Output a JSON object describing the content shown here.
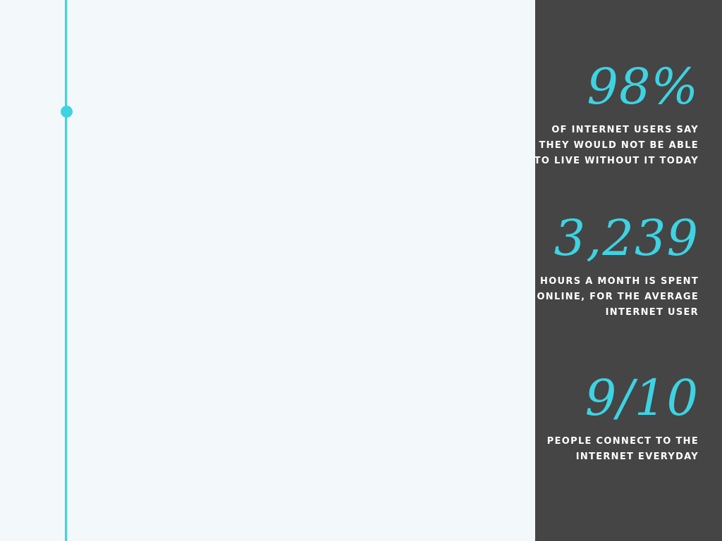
{
  "colors": {
    "background_light": "#f3f9fa",
    "panel_dark": "#454545",
    "accent": "#3dd3e3",
    "text_light": "#ffffff"
  },
  "stats": [
    {
      "value": "98%",
      "description": "OF INTERNET USERS SAY\nTHEY WOULD NOT BE ABLE\nTO LIVE WITHOUT IT TODAY"
    },
    {
      "value": "3,239",
      "description": "HOURS A MONTH IS SPENT\nONLINE, FOR THE AVERAGE\nINTERNET USER"
    },
    {
      "value": "9/10",
      "description": "PEOPLE CONNECT TO THE\nINTERNET EVERYDAY"
    }
  ]
}
